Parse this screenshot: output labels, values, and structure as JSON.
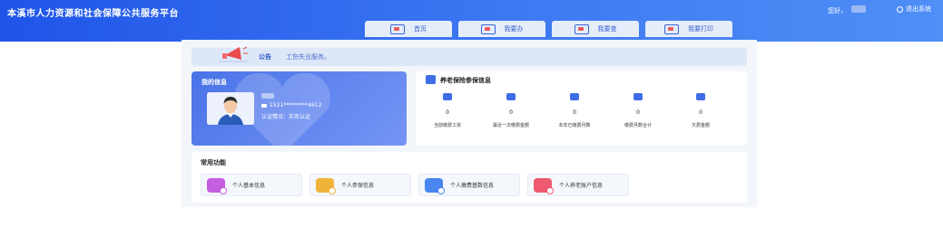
{
  "header": {
    "title": "本溪市人力资源和社会保障公共服务平台",
    "greeting": "您好，",
    "logout_label": "退出系统"
  },
  "tabs": [
    {
      "label": "首页"
    },
    {
      "label": "我要办"
    },
    {
      "label": "我要查"
    },
    {
      "label": "我要打印"
    }
  ],
  "notice": {
    "label": "公告",
    "text": "工伤失业服务。"
  },
  "my_info": {
    "title": "我的信息",
    "phone": "1521*********4612",
    "auth_label": "认证情况：",
    "auth_status": "实名认证"
  },
  "pension": {
    "title": "养老保险参保信息",
    "stats": [
      {
        "value": "0",
        "label": "当前缴费工资",
        "icon": "wallet-icon"
      },
      {
        "value": "0",
        "label": "最近一次缴费金额",
        "icon": "money-bag-icon"
      },
      {
        "value": "0",
        "label": "本年已缴费月数",
        "icon": "card-icon"
      },
      {
        "value": "0",
        "label": "缴费月数合计",
        "icon": "checklist-icon"
      },
      {
        "value": "0",
        "label": "欠费金额",
        "icon": "coins-icon"
      }
    ]
  },
  "common_functions": {
    "title": "常用功能",
    "items": [
      {
        "label": "个人基本信息",
        "color": "#c65ee0"
      },
      {
        "label": "个人参保信息",
        "color": "#f0b33a"
      },
      {
        "label": "个人缴费基数信息",
        "color": "#4a86f0"
      },
      {
        "label": "个人养老账户信息",
        "color": "#ee5a6f"
      }
    ]
  },
  "colors": {
    "header_blue": "#2f66ee",
    "accent_blue": "#3f6de6",
    "panel_bg": "#f2f5fa"
  }
}
